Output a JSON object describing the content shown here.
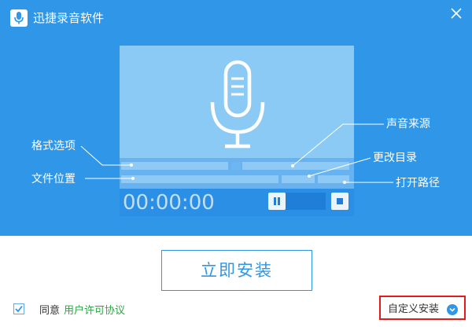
{
  "window": {
    "title": "迅捷录音软件",
    "app_icon": "microphone-icon",
    "close_icon": "close-icon"
  },
  "preview": {
    "time_display": "00:00:00",
    "mic_icon": "microphone-icon",
    "pause_icon": "pause-icon",
    "stop_icon": "stop-icon"
  },
  "labels": {
    "format_options": "格式选项",
    "file_location": "文件位置",
    "sound_source": "声音来源",
    "change_directory": "更改目录",
    "open_path": "打开路径"
  },
  "install_button": {
    "label": "立即安装"
  },
  "agreement": {
    "checked": true,
    "agree_text": "同意",
    "license_link": "用户许可协议"
  },
  "custom_install": {
    "label": "自定义安装",
    "icon": "chevron-down-icon"
  },
  "colors": {
    "primary": "#2f96e8",
    "link_green": "#2fa447",
    "highlight_red": "#e31b1b"
  }
}
